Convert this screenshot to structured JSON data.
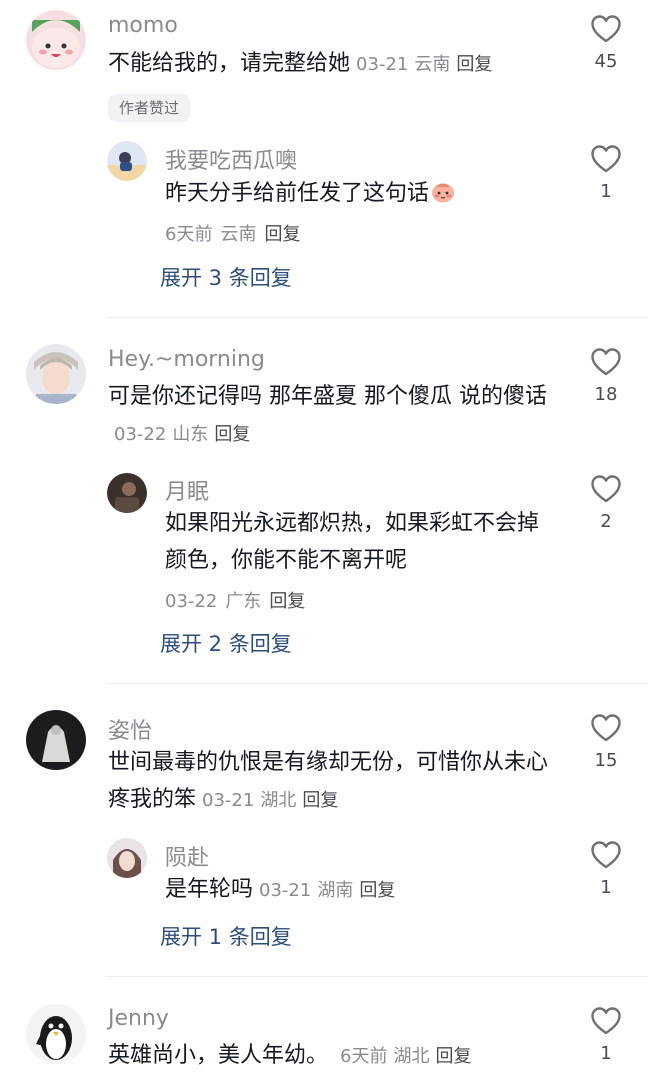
{
  "comments": [
    {
      "username": "momo",
      "text": "不能给我的，请完整给她",
      "date": "03-21",
      "location": "云南",
      "reply_label": "回复",
      "likes": "45",
      "author_tag": "作者赞过",
      "reply": {
        "username": "我要吃西瓜噢",
        "text": "昨天分手给前任发了这句话",
        "time": "6天前",
        "location": "云南",
        "reply_label": "回复",
        "likes": "1"
      },
      "expand": "展开 3 条回复"
    },
    {
      "username": "Hey.~morning",
      "text": "可是你还记得吗 那年盛夏 那个傻瓜 说的傻话",
      "date": "03-22",
      "location": "山东",
      "reply_label": "回复",
      "likes": "18",
      "reply": {
        "username": "月眠",
        "text": "如果阳光永远都炽热，如果彩虹不会掉颜色，你能不能不离开呢",
        "date": "03-22",
        "location": "广东",
        "reply_label": "回复",
        "likes": "2"
      },
      "expand": "展开 2 条回复"
    },
    {
      "username": "姿怡",
      "text": "世间最毒的仇恨是有缘却无份，可惜你从未心疼我的笨",
      "date": "03-21",
      "location": "湖北",
      "reply_label": "回复",
      "likes": "15",
      "reply": {
        "username": "陨赴",
        "text": "是年轮吗",
        "date": "03-21",
        "location": "湖南",
        "reply_label": "回复",
        "likes": "1"
      },
      "expand": "展开 1 条回复"
    },
    {
      "username": "Jenny",
      "text": "英雄尚小，美人年幼。",
      "time": "6天前",
      "location": "湖北",
      "reply_label": "回复",
      "likes": "1"
    }
  ],
  "colors": {
    "heart_stroke": "#6f7076",
    "link": "#2b4e7c",
    "muted": "#8a8b91"
  }
}
